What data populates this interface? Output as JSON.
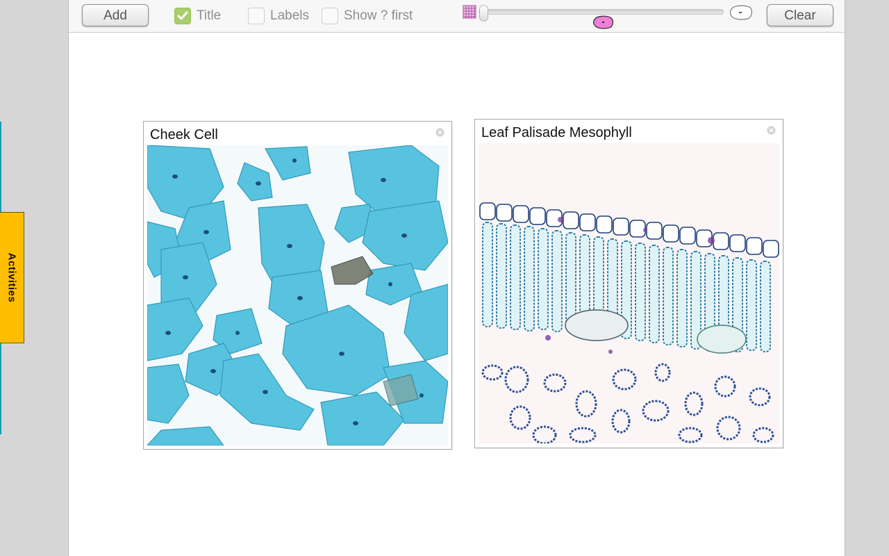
{
  "sidebar": {
    "activities_tab_label": "Activities"
  },
  "toolbar": {
    "add_label": "Add",
    "clear_label": "Clear",
    "title_checkbox": {
      "label": "Title",
      "checked": true
    },
    "labels_checkbox": {
      "label": "Labels",
      "checked": false
    },
    "show_first_checkbox": {
      "label": "Show ? first",
      "checked": false
    },
    "zoom_slider": {
      "min_icon": "cell-group-icon",
      "max_icon": "single-cell-icon",
      "value": 0
    },
    "marker_icon": "pink-cell-icon",
    "colors": {
      "checkbox_checked": "#a9cf6b",
      "marker": "#f07fd6"
    }
  },
  "panels": [
    {
      "title": "Cheek Cell",
      "close_icon": "close-circle-icon",
      "image_subject": "cheek-cell-micrograph"
    },
    {
      "title": "Leaf Palisade Mesophyll",
      "close_icon": "close-circle-icon",
      "image_subject": "leaf-palisade-mesophyll-micrograph"
    }
  ],
  "colors": {
    "activities_tab": "#ffbf00",
    "cheek_stain": "#3cb8d6",
    "leaf_stain": "#2a7fa8"
  }
}
